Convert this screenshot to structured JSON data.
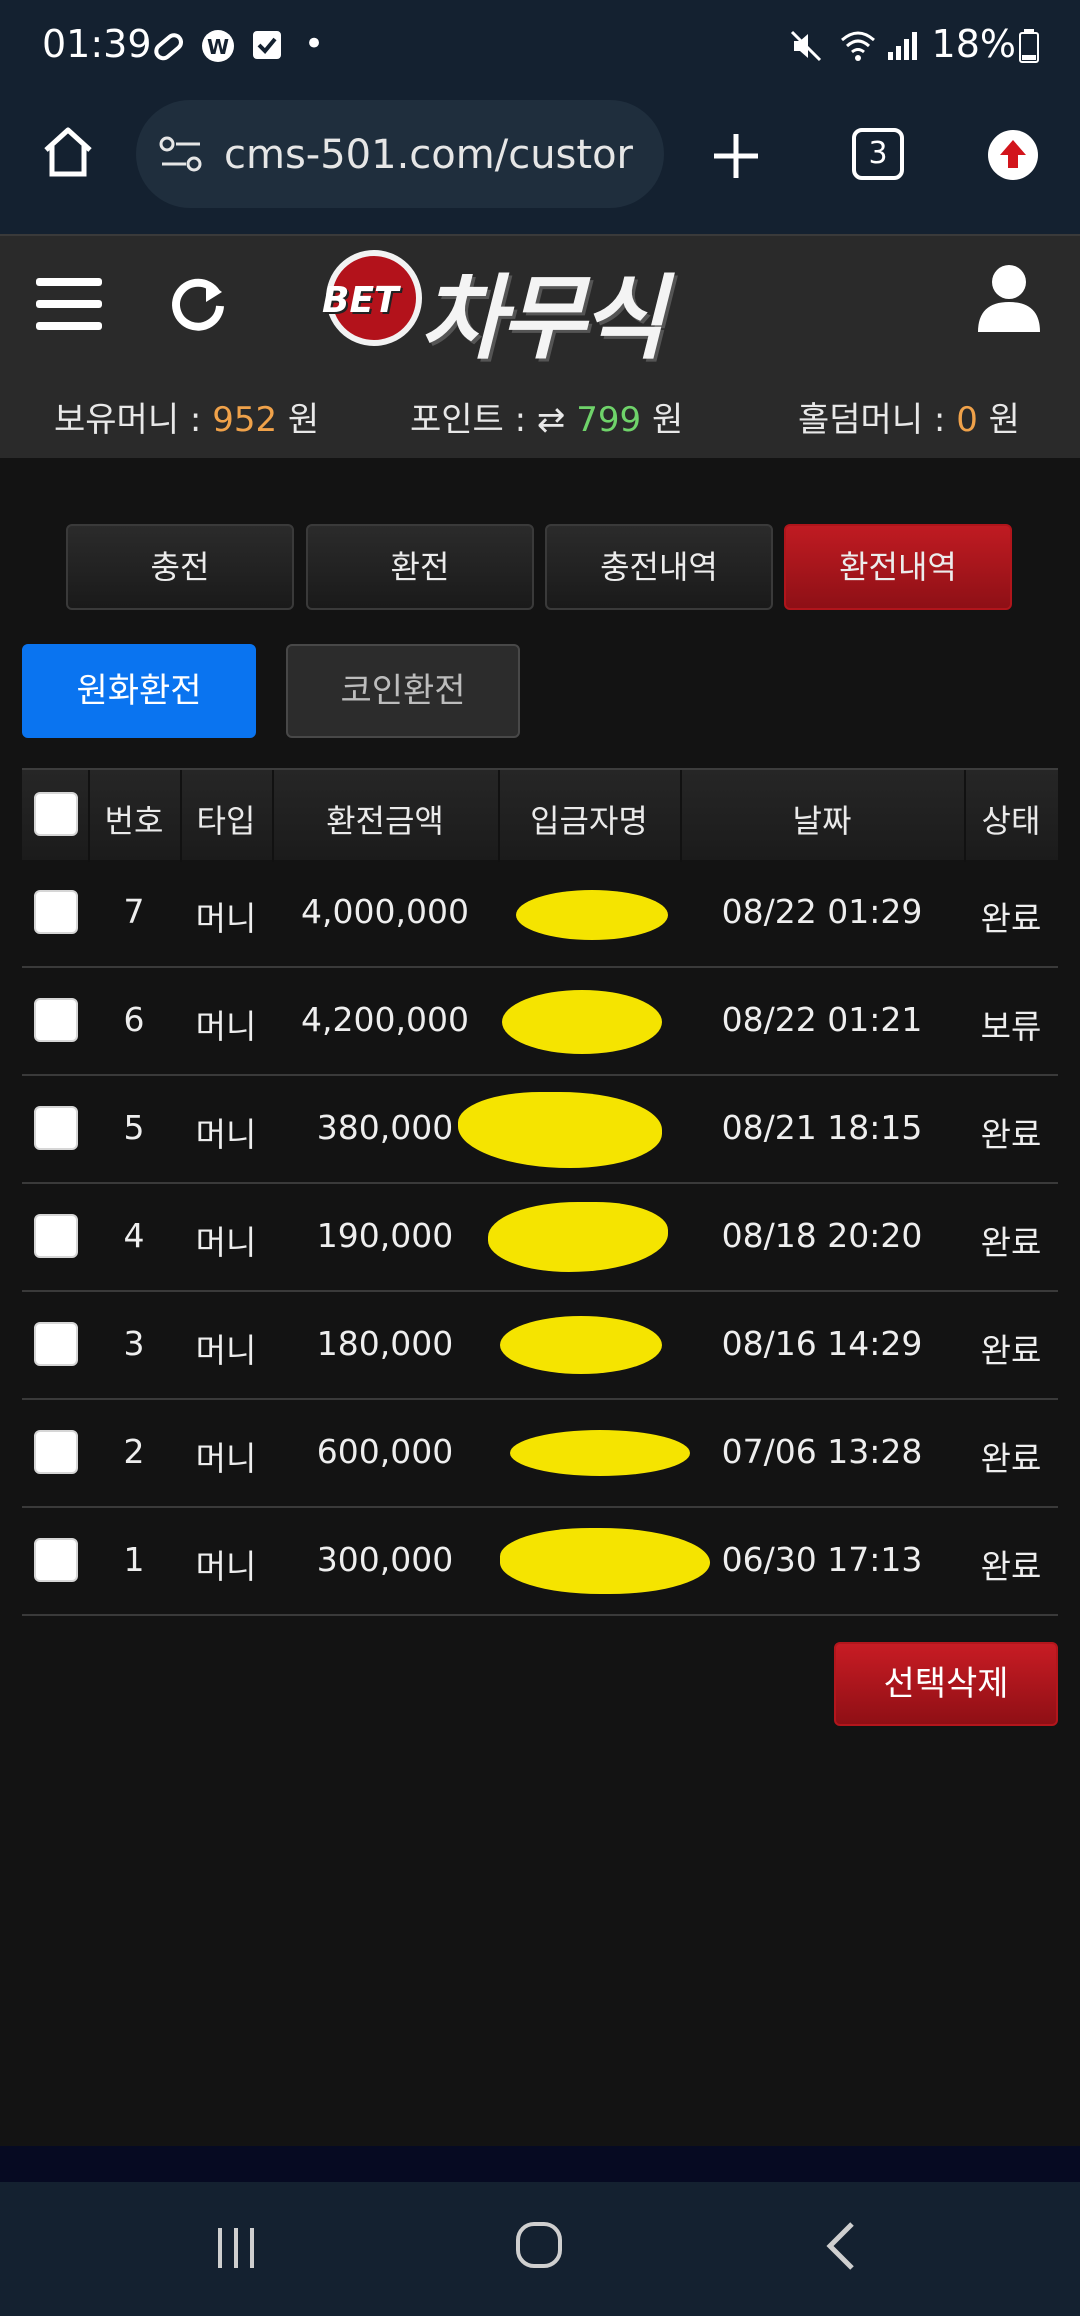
{
  "status_bar": {
    "time": "01:39",
    "battery": "18%",
    "dot": "•"
  },
  "browser": {
    "url": "cms-501.com/custor",
    "tab_count": "3"
  },
  "site": {
    "logo_small": "BET",
    "logo_main": "차무식",
    "balances": {
      "money_label": "보유머니 :",
      "money_value": "952",
      "money_unit": "원",
      "point_label": "포인트 :",
      "point_icon": "⇄",
      "point_value": "799",
      "point_unit": "원",
      "holdem_label": "홀덤머니 :",
      "holdem_value": "0",
      "holdem_unit": "원"
    }
  },
  "tabs": [
    {
      "label": "충전",
      "active": false
    },
    {
      "label": "환전",
      "active": false
    },
    {
      "label": "충전내역",
      "active": false
    },
    {
      "label": "환전내역",
      "active": true
    }
  ],
  "subtabs": [
    {
      "label": "원화환전",
      "active": true
    },
    {
      "label": "코인환전",
      "active": false
    }
  ],
  "table": {
    "headers": {
      "num": "번호",
      "type": "타입",
      "amount": "환전금액",
      "name": "입금자명",
      "date": "날짜",
      "status": "상태"
    },
    "rows": [
      {
        "num": "7",
        "type": "머니",
        "amount": "4,000,000",
        "date": "08/22 01:29",
        "status": "완료"
      },
      {
        "num": "6",
        "type": "머니",
        "amount": "4,200,000",
        "date": "08/22 01:21",
        "status": "보류"
      },
      {
        "num": "5",
        "type": "머니",
        "amount": "380,000",
        "date": "08/21 18:15",
        "status": "완료"
      },
      {
        "num": "4",
        "type": "머니",
        "amount": "190,000",
        "date": "08/18 20:20",
        "status": "완료"
      },
      {
        "num": "3",
        "type": "머니",
        "amount": "180,000",
        "date": "08/16 14:29",
        "status": "완료"
      },
      {
        "num": "2",
        "type": "머니",
        "amount": "600,000",
        "date": "07/06 13:28",
        "status": "완료"
      },
      {
        "num": "1",
        "type": "머니",
        "amount": "300,000",
        "date": "06/30 17:13",
        "status": "완료"
      }
    ]
  },
  "actions": {
    "delete_selected": "선택삭제"
  },
  "colors": {
    "accent_red": "#b0151b",
    "accent_blue": "#0a74f0",
    "money_orange": "#f0a24a",
    "point_green": "#6fd36a",
    "redaction_yellow": "#f5e400"
  },
  "icons": {
    "status_bar": [
      "link-icon",
      "w-app-icon",
      "checkbox-notification-icon",
      "mute-icon",
      "wifi-icon",
      "signal-icon",
      "battery-icon"
    ],
    "browser": [
      "home-icon",
      "site-settings-icon",
      "new-tab-icon",
      "tab-switcher-icon",
      "update-icon"
    ],
    "site": [
      "menu-icon",
      "refresh-icon",
      "user-icon"
    ],
    "nav": [
      "recent-apps-icon",
      "home-nav-icon",
      "back-icon"
    ]
  }
}
